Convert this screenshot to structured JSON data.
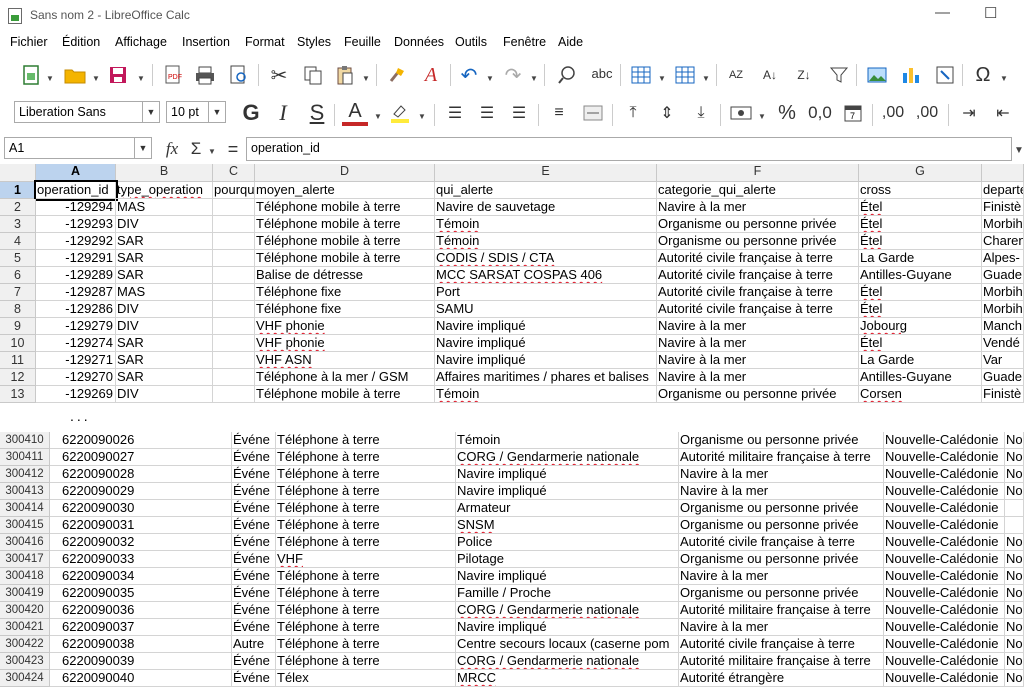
{
  "window": {
    "title": "Sans nom 2 - LibreOffice Calc",
    "minimize": "—",
    "maximize": "☐"
  },
  "menu": [
    "Fichier",
    "Édition",
    "Affichage",
    "Insertion",
    "Format",
    "Styles",
    "Feuille",
    "Données",
    "Outils",
    "Fenêtre",
    "Aide"
  ],
  "format_bar": {
    "font_name": "Liberation Sans",
    "font_size": "10 pt",
    "bold": "G",
    "italic": "I",
    "underline": "S",
    "font_color": "A",
    "percent": "%",
    "decimal": "0,0",
    "add_dec": ",00",
    "del_dec": ",00"
  },
  "formula_bar": {
    "name_box": "A1",
    "fx": "fx",
    "sum": "Σ",
    "equals": "=",
    "content": "operation_id"
  },
  "colors": {
    "accent_selection": "#bcd3ee",
    "header_bg": "#f0f0f0",
    "spell_underline": "#d12"
  },
  "icons": [
    "new-doc-icon",
    "open-folder-icon",
    "save-icon",
    "export-pdf-icon",
    "print-icon",
    "print-preview-icon",
    "cut-icon",
    "copy-icon",
    "paste-icon",
    "clone-format-icon",
    "clear-format-icon",
    "undo-icon",
    "redo-icon",
    "find-replace-icon",
    "spellcheck-icon",
    "row-icon",
    "column-icon",
    "sort-icon",
    "sort-ascending-icon",
    "sort-descending-icon",
    "autofilter-icon",
    "image-icon",
    "chart-icon",
    "pivot-table-icon",
    "special-char-icon"
  ],
  "upper": {
    "columns": [
      "A",
      "B",
      "C",
      "D",
      "E",
      "F",
      "G"
    ],
    "rows": [
      {
        "n": "1",
        "a": "operation_id",
        "b": "type_operation",
        "c": "pourqu",
        "d": "moyen_alerte",
        "e": "qui_alerte",
        "f": "categorie_qui_alerte",
        "g": "cross",
        "h": "departe"
      },
      {
        "n": "2",
        "a": "-129294",
        "b": "MAS",
        "c": "",
        "d": "Téléphone mobile à terre",
        "e": "Navire de sauvetage",
        "f": "Navire à la mer",
        "g": "Étel",
        "h": "Finistè"
      },
      {
        "n": "3",
        "a": "-129293",
        "b": "DIV",
        "c": "",
        "d": "Téléphone mobile à terre",
        "e": "Témoin",
        "f": "Organisme ou personne privée",
        "g": "Étel",
        "h": "Morbih"
      },
      {
        "n": "4",
        "a": "-129292",
        "b": "SAR",
        "c": "",
        "d": "Téléphone mobile à terre",
        "e": "Témoin",
        "f": "Organisme ou personne privée",
        "g": "Étel",
        "h": "Charen"
      },
      {
        "n": "5",
        "a": "-129291",
        "b": "SAR",
        "c": "",
        "d": "Téléphone mobile à terre",
        "e": "CODIS / SDIS / CTA",
        "f": "Autorité civile française à terre",
        "g": "La Garde",
        "h": "Alpes-"
      },
      {
        "n": "6",
        "a": "-129289",
        "b": "SAR",
        "c": "",
        "d": "Balise de détresse",
        "e": "MCC SARSAT COSPAS 406",
        "f": "Autorité civile française à terre",
        "g": "Antilles-Guyane",
        "h": "Guade"
      },
      {
        "n": "7",
        "a": "-129287",
        "b": "MAS",
        "c": "",
        "d": "Téléphone fixe",
        "e": "Port",
        "f": "Autorité civile française à terre",
        "g": "Étel",
        "h": "Morbih"
      },
      {
        "n": "8",
        "a": "-129286",
        "b": "DIV",
        "c": "",
        "d": "Téléphone fixe",
        "e": "SAMU",
        "f": "Autorité civile française à terre",
        "g": "Étel",
        "h": "Morbih"
      },
      {
        "n": "9",
        "a": "-129279",
        "b": "DIV",
        "c": "",
        "d": "VHF phonie",
        "e": "Navire impliqué",
        "f": "Navire à la mer",
        "g": "Jobourg",
        "h": "Manch"
      },
      {
        "n": "10",
        "a": "-129274",
        "b": "SAR",
        "c": "",
        "d": "VHF phonie",
        "e": "Navire impliqué",
        "f": "Navire à la mer",
        "g": "Étel",
        "h": "Vendé"
      },
      {
        "n": "11",
        "a": "-129271",
        "b": "SAR",
        "c": "",
        "d": "VHF ASN",
        "e": "Navire impliqué",
        "f": "Navire à la mer",
        "g": "La Garde",
        "h": "Var"
      },
      {
        "n": "12",
        "a": "-129270",
        "b": "SAR",
        "c": "",
        "d": "Téléphone à la mer / GSM",
        "e": "Affaires maritimes / phares et balises",
        "f": "Navire à la mer",
        "g": "Antilles-Guyane",
        "h": "Guade"
      },
      {
        "n": "13",
        "a": "-129269",
        "b": "DIV",
        "c": "",
        "d": "Téléphone mobile à terre",
        "e": "Témoin",
        "f": "Organisme ou personne privée",
        "g": "Corsen",
        "h": "Finistè"
      }
    ]
  },
  "ellipsis": "...",
  "lower": {
    "rows": [
      {
        "n": "300410",
        "a": "6220090026",
        "c": "Événe",
        "d": "Téléphone à terre",
        "e": "Témoin",
        "f": "Organisme ou personne privée",
        "g": "Nouvelle-Calédonie",
        "h": "No"
      },
      {
        "n": "300411",
        "a": "6220090027",
        "c": "Événe",
        "d": "Téléphone à terre",
        "e": "CORG / Gendarmerie nationale",
        "f": "Autorité militaire française à terre",
        "g": "Nouvelle-Calédonie",
        "h": "No"
      },
      {
        "n": "300412",
        "a": "6220090028",
        "c": "Événe",
        "d": "Téléphone à terre",
        "e": "Navire impliqué",
        "f": "Navire à la mer",
        "g": "Nouvelle-Calédonie",
        "h": "No"
      },
      {
        "n": "300413",
        "a": "6220090029",
        "c": "Événe",
        "d": "Téléphone à terre",
        "e": "Navire impliqué",
        "f": "Navire à la mer",
        "g": "Nouvelle-Calédonie",
        "h": "No"
      },
      {
        "n": "300414",
        "a": "6220090030",
        "c": "Événe",
        "d": "Téléphone à terre",
        "e": "Armateur",
        "f": "Organisme ou personne privée",
        "g": "Nouvelle-Calédonie",
        "h": ""
      },
      {
        "n": "300415",
        "a": "6220090031",
        "c": "Événe",
        "d": "Téléphone à terre",
        "e": "SNSM",
        "f": "Organisme ou personne privée",
        "g": "Nouvelle-Calédonie",
        "h": ""
      },
      {
        "n": "300416",
        "a": "6220090032",
        "c": "Événe",
        "d": "Téléphone à terre",
        "e": "Police",
        "f": "Autorité civile française à terre",
        "g": "Nouvelle-Calédonie",
        "h": "No"
      },
      {
        "n": "300417",
        "a": "6220090033",
        "c": "Événe",
        "d": "VHF",
        "e": "Pilotage",
        "f": "Organisme ou personne privée",
        "g": "Nouvelle-Calédonie",
        "h": "No"
      },
      {
        "n": "300418",
        "a": "6220090034",
        "c": "Événe",
        "d": "Téléphone à terre",
        "e": "Navire impliqué",
        "f": "Navire à la mer",
        "g": "Nouvelle-Calédonie",
        "h": "No"
      },
      {
        "n": "300419",
        "a": "6220090035",
        "c": "Événe",
        "d": "Téléphone à terre",
        "e": "Famille / Proche",
        "f": "Organisme ou personne privée",
        "g": "Nouvelle-Calédonie",
        "h": "No"
      },
      {
        "n": "300420",
        "a": "6220090036",
        "c": "Événe",
        "d": "Téléphone à terre",
        "e": "CORG / Gendarmerie nationale",
        "f": "Autorité militaire française à terre",
        "g": "Nouvelle-Calédonie",
        "h": "No"
      },
      {
        "n": "300421",
        "a": "6220090037",
        "c": "Événe",
        "d": "Téléphone à terre",
        "e": "Navire impliqué",
        "f": "Navire à la mer",
        "g": "Nouvelle-Calédonie",
        "h": "No"
      },
      {
        "n": "300422",
        "a": "6220090038",
        "c": "Autre",
        "d": "Téléphone à terre",
        "e": "Centre secours locaux (caserne pom",
        "f": "Autorité civile française à terre",
        "g": "Nouvelle-Calédonie",
        "h": "No"
      },
      {
        "n": "300423",
        "a": "6220090039",
        "c": "Événe",
        "d": "Téléphone à terre",
        "e": "CORG / Gendarmerie nationale",
        "f": "Autorité militaire française à terre",
        "g": "Nouvelle-Calédonie",
        "h": "No"
      },
      {
        "n": "300424",
        "a": "6220090040",
        "c": "Événe",
        "d": "Télex",
        "e": "MRCC",
        "f": "Autorité étrangère",
        "g": "Nouvelle-Calédonie",
        "h": "No"
      }
    ]
  }
}
